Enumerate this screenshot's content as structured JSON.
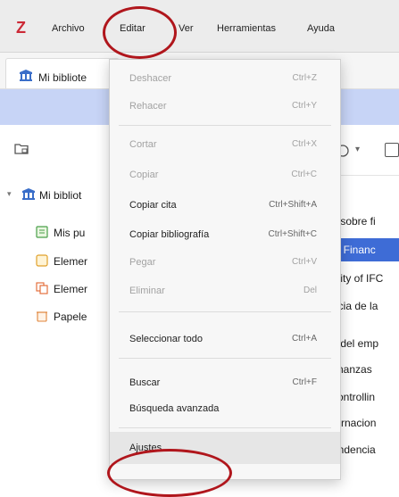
{
  "menubar": {
    "logo": "Z",
    "items": [
      "Archivo",
      "Editar",
      "Ver",
      "Herramientas",
      "Ayuda"
    ]
  },
  "tab": {
    "label": "Mi bibliote"
  },
  "tree": {
    "root": "Mi bibliot",
    "children": [
      "Mis pu",
      "Elemer",
      "Elemer",
      "Papele"
    ]
  },
  "list": {
    "rows": [
      "s sobre fi",
      "al Financ",
      "ality of IFC",
      "ncia de la",
      "s del emp",
      "finanzas",
      "controllin",
      "ternacion",
      "ondencia"
    ],
    "selected_index": 1
  },
  "edit_menu": {
    "items": [
      {
        "label": "Deshacer",
        "accel": "Ctrl+Z",
        "enabled": false
      },
      {
        "label": "Rehacer",
        "accel": "Ctrl+Y",
        "enabled": false
      },
      {
        "label": "Cortar",
        "accel": "Ctrl+X",
        "enabled": false
      },
      {
        "label": "Copiar",
        "accel": "Ctrl+C",
        "enabled": false
      },
      {
        "label": "Copiar cita",
        "accel": "Ctrl+Shift+A",
        "enabled": true
      },
      {
        "label": "Copiar bibliografía",
        "accel": "Ctrl+Shift+C",
        "enabled": true
      },
      {
        "label": "Pegar",
        "accel": "Ctrl+V",
        "enabled": false
      },
      {
        "label": "Eliminar",
        "accel": "Del",
        "enabled": false
      },
      {
        "label": "Seleccionar todo",
        "accel": "Ctrl+A",
        "enabled": true
      },
      {
        "label": "Buscar",
        "accel": "Ctrl+F",
        "enabled": true
      },
      {
        "label": "Búsqueda avanzada",
        "accel": "",
        "enabled": true
      },
      {
        "label": "Ajustes",
        "accel": "",
        "enabled": true
      }
    ]
  },
  "colors": {
    "accent_red": "#b0161c",
    "selection_blue": "#3e6cd6",
    "banner_blue": "#c7d4f6",
    "logo_red": "#cc2936"
  }
}
